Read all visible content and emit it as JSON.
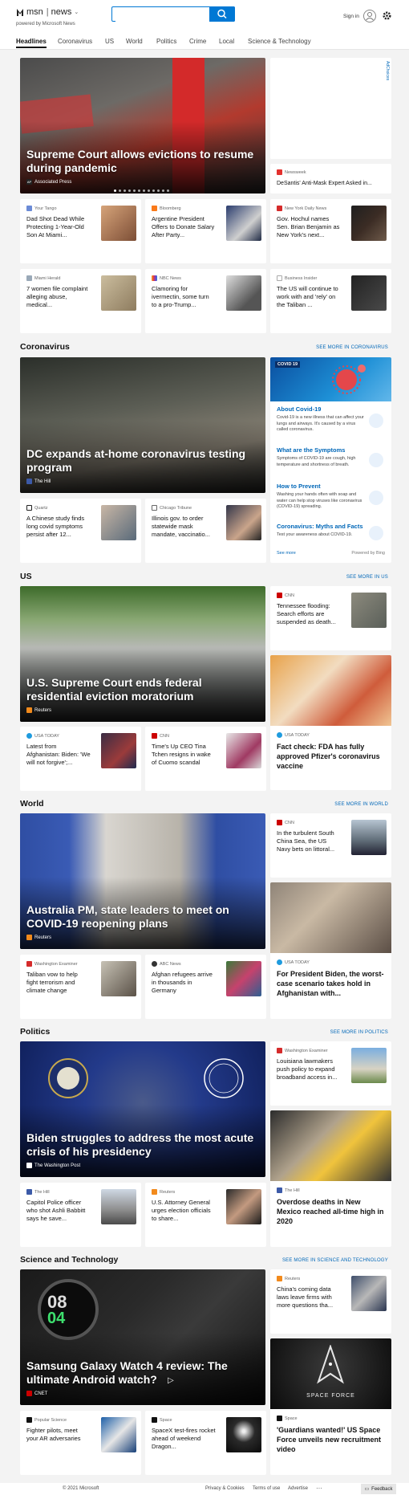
{
  "header": {
    "brand": "msn",
    "news": "news",
    "sub": "powered by Microsoft News",
    "search_placeholder": "",
    "signin": "Sign in"
  },
  "nav": [
    "Headlines",
    "Coronavirus",
    "US",
    "World",
    "Politics",
    "Crime",
    "Local",
    "Science & Technology"
  ],
  "ad": {
    "label": "AdChoices"
  },
  "headlines": {
    "hero": {
      "title": "Supreme Court allows evictions to resume during pandemic",
      "source": "Associated Press",
      "badge": "AP"
    },
    "side": {
      "source": "Newsweek",
      "title": "DeSantis' Anti-Mask Expert Asked in..."
    },
    "row1": [
      {
        "source": "Your Tango",
        "title": "Dad Shot Dead While Protecting 1-Year-Old Son At Miami..."
      },
      {
        "source": "Bloomberg",
        "title": "Argentine President Offers to Donate Salary After Party..."
      },
      {
        "source": "New York Daily News",
        "title": "Gov. Hochul names Sen. Brian Benjamin as New York's next..."
      }
    ],
    "row2": [
      {
        "source": "Miami Herald",
        "title": "7 women file complaint alleging abuse, medical..."
      },
      {
        "source": "NBC News",
        "title": "Clamoring for ivermectin, some turn to a pro-Trump..."
      },
      {
        "source": "Business Insider",
        "title": "The US will continue to work with and 'rely' on the Taliban ..."
      }
    ]
  },
  "coronavirus": {
    "title": "Coronavirus",
    "more": "SEE MORE IN CORONAVIRUS",
    "hero": {
      "title": "DC expands at-home coronavirus testing program",
      "source": "The Hill"
    },
    "small": [
      {
        "source": "Quartz",
        "title": "A Chinese study finds long covid symptoms persist after 12..."
      },
      {
        "source": "Chicago Tribune",
        "title": "Illinois gov. to order statewide mask mandate, vaccinatio..."
      }
    ],
    "panel": {
      "badge": "COVID 19",
      "items": [
        {
          "title": "About Covid-19",
          "desc": "Covid-19 is a new illness that can affect your lungs and airways. It's caused by a virus called coronavirus."
        },
        {
          "title": "What are the Symptoms",
          "desc": "Symptoms of COVID-19 are cough, high temperature and shortness of breath."
        },
        {
          "title": "How to Prevent",
          "desc": "Washing your hands often with soap and water can help stop viruses like coronavirus (COVID-19) spreading."
        },
        {
          "title": "Coronavirus: Myths and Facts",
          "desc": "Test your awareness about COVID-19."
        }
      ],
      "see_more": "See more",
      "powered": "Powered by Bing"
    }
  },
  "us": {
    "title": "US",
    "more": "SEE MORE IN US",
    "hero": {
      "title": "U.S. Supreme Court ends federal residential eviction moratorium",
      "source": "Reuters"
    },
    "side": {
      "source": "CNN",
      "title": "Tennessee flooding: Search efforts are suspended as death..."
    },
    "tall": {
      "source": "USA TODAY",
      "title": "Fact check: FDA has fully approved Pfizer's coronavirus vaccine"
    },
    "small": [
      {
        "source": "USA TODAY",
        "title": "Latest from Afghanistan: Biden: 'We will not forgive';..."
      },
      {
        "source": "CNN",
        "title": "Time's Up CEO Tina Tchen resigns in wake of Cuomo scandal"
      }
    ]
  },
  "world": {
    "title": "World",
    "more": "SEE MORE IN WORLD",
    "hero": {
      "title": "Australia PM, state leaders to meet on COVID-19 reopening plans",
      "source": "Reuters"
    },
    "side": {
      "source": "CNN",
      "title": "In the turbulent South China Sea, the US Navy bets on littoral..."
    },
    "tall": {
      "source": "USA TODAY",
      "title": "For President Biden, the worst-case scenario takes hold in Afghanistan with..."
    },
    "small": [
      {
        "source": "Washington Examiner",
        "title": "Taliban vow to help fight terrorism and climate change"
      },
      {
        "source": "ABC News",
        "title": "Afghan refugees arrive in thousands in Germany"
      }
    ]
  },
  "politics": {
    "title": "Politics",
    "more": "SEE MORE IN POLITICS",
    "hero": {
      "title": "Biden struggles to address the most acute crisis of his presidency",
      "source": "The Washington Post"
    },
    "side": {
      "source": "Washington Examiner",
      "title": "Louisiana lawmakers push policy to expand broadband access in..."
    },
    "tall": {
      "source": "The Hill",
      "title": "Overdose deaths in New Mexico reached all-time high in 2020"
    },
    "small": [
      {
        "source": "The Hill",
        "title": "Capitol Police officer who shot Ashli Babbitt says he save..."
      },
      {
        "source": "Reuters",
        "title": "U.S. Attorney General urges election officials to share..."
      }
    ]
  },
  "scitech": {
    "title": "Science and Technology",
    "more": "SEE MORE IN SCIENCE AND TECHNOLOGY",
    "hero": {
      "title": "Samsung Galaxy Watch 4 review: The ultimate Android watch?",
      "source": "CNET"
    },
    "side": {
      "source": "Reuters",
      "title": "China's coming data laws leave firms with more questions tha..."
    },
    "tall": {
      "source": "Space",
      "title": "'Guardians wanted!' US Space Force unveils new recruitment video",
      "img_text": "SPACE FORCE"
    },
    "small": [
      {
        "source": "Popular Science",
        "title": "Fighter pilots, meet your AR adversaries"
      },
      {
        "source": "Space",
        "title": "SpaceX test-fires rocket ahead of weekend Dragon..."
      }
    ]
  },
  "footer": {
    "copyright": "© 2021 Microsoft",
    "links": [
      "Privacy & Cookies",
      "Terms of use",
      "Advertise"
    ],
    "feedback": "Feedback"
  }
}
